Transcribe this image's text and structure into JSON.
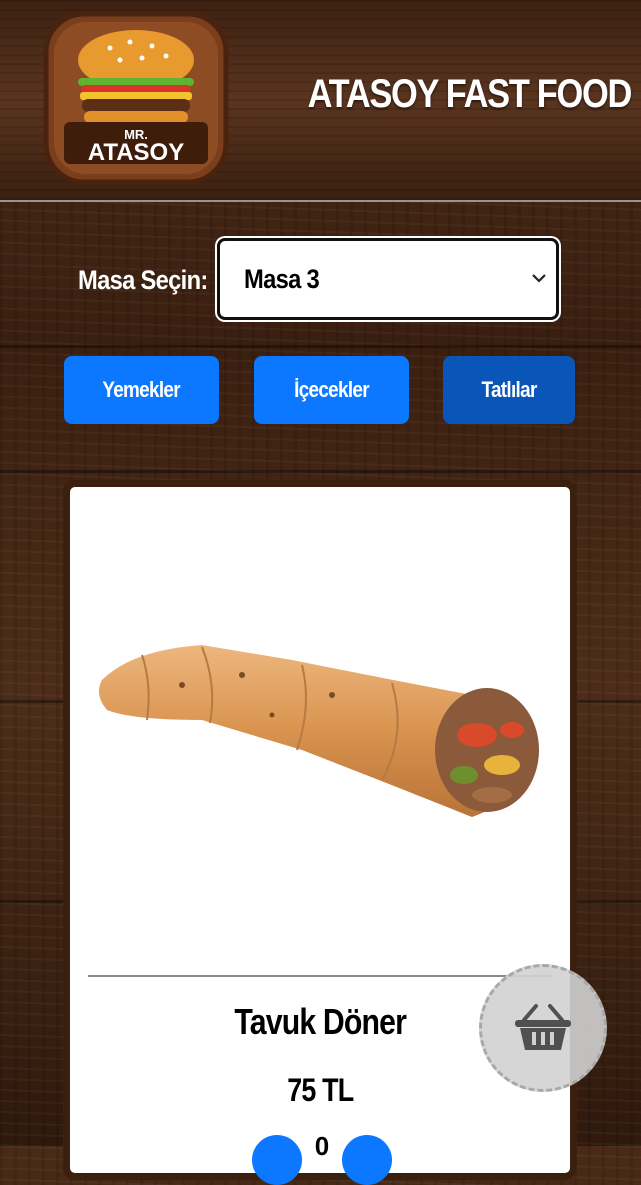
{
  "header": {
    "logo_small": "MR.",
    "logo_name": "ATASOY",
    "brand_title": "ATASOY FAST FOOD"
  },
  "table_select": {
    "label": "Masa Seçin:",
    "selected": "Masa 3"
  },
  "categories": [
    {
      "label": "Yemekler",
      "color": "#0b78ff"
    },
    {
      "label": "İçecekler",
      "color": "#0b78ff"
    },
    {
      "label": "Tatlılar",
      "color": "#0a56b8"
    }
  ],
  "product": {
    "name": "Tavuk Döner",
    "price": "75 TL",
    "quantity": "0"
  },
  "icons": {
    "cart": "basket-icon",
    "dropdown": "chevron-down-icon"
  }
}
